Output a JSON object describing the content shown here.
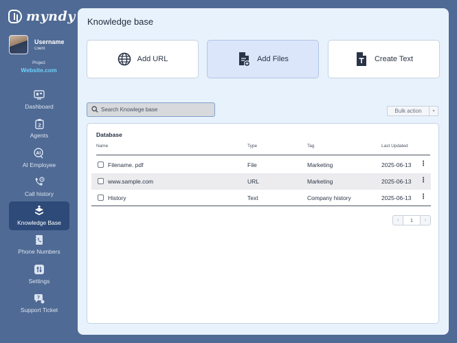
{
  "brand": {
    "name": "myndy"
  },
  "user": {
    "name": "Username",
    "role": "Client"
  },
  "project": {
    "label": "Project",
    "value": "Website.com"
  },
  "nav": [
    {
      "label": "Dashboard",
      "icon": "dashboard-icon"
    },
    {
      "label": "Agents",
      "icon": "agents-icon"
    },
    {
      "label": "AI Employee",
      "icon": "ai-employee-icon"
    },
    {
      "label": "Call history",
      "icon": "call-history-icon"
    },
    {
      "label": "Knowledge Base",
      "icon": "knowledge-base-icon",
      "active": true
    },
    {
      "label": "Phone Numbers",
      "icon": "phone-numbers-icon"
    },
    {
      "label": "Settings",
      "icon": "settings-icon"
    },
    {
      "label": "Support Ticket",
      "icon": "support-ticket-icon"
    }
  ],
  "page": {
    "title": "Knowledge base"
  },
  "actions": {
    "add_url": "Add URL",
    "add_files": "Add Files",
    "create_text": "Create Text"
  },
  "search": {
    "placeholder": "Search Knowlege base"
  },
  "bulk_action": {
    "label": "Bulk action"
  },
  "table": {
    "title": "Database",
    "columns": {
      "name": "Name",
      "type": "Type",
      "tag": "Tag",
      "updated": "Last Updated"
    },
    "rows": [
      {
        "name": "Filename. pdf",
        "type": "File",
        "tag": "Marketing",
        "updated": "2025-06-13"
      },
      {
        "name": "www.sample.com",
        "type": "URL",
        "tag": "Marketing",
        "updated": "2025-06-13"
      },
      {
        "name": "History",
        "type": "Text",
        "tag": "Company history",
        "updated": "2025-06-13"
      }
    ]
  },
  "pagination": {
    "current": "1"
  },
  "colors": {
    "sidebar": "#4f6a94",
    "active_nav": "#2e4a78",
    "main_bg": "#e8f2fc",
    "project_accent": "#6fd3ff"
  }
}
